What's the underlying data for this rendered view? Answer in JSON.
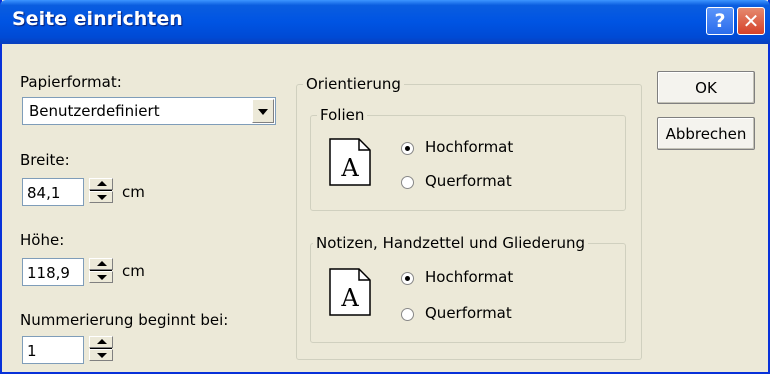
{
  "title": "Seite einrichten",
  "titlebar": {
    "help_glyph": "?",
    "close_glyph": "✕"
  },
  "paper": {
    "format_label": "Papierformat:",
    "format_value": "Benutzerdefiniert"
  },
  "width": {
    "label": "Breite:",
    "value": "84,1",
    "unit": "cm"
  },
  "height": {
    "label": "Höhe:",
    "value": "118,9",
    "unit": "cm"
  },
  "numbering": {
    "label": "Nummerierung beginnt bei:",
    "value": "1"
  },
  "orientation": {
    "legend": "Orientierung",
    "slides": {
      "legend": "Folien",
      "options": [
        "Hochformat",
        "Querformat"
      ],
      "selected": "Hochformat"
    },
    "notes": {
      "legend": "Notizen, Handzettel und Gliederung",
      "options": [
        "Hochformat",
        "Querformat"
      ],
      "selected": "Hochformat"
    },
    "page_icon_letter": "A"
  },
  "buttons": {
    "ok": "OK",
    "cancel": "Abbrechen"
  }
}
